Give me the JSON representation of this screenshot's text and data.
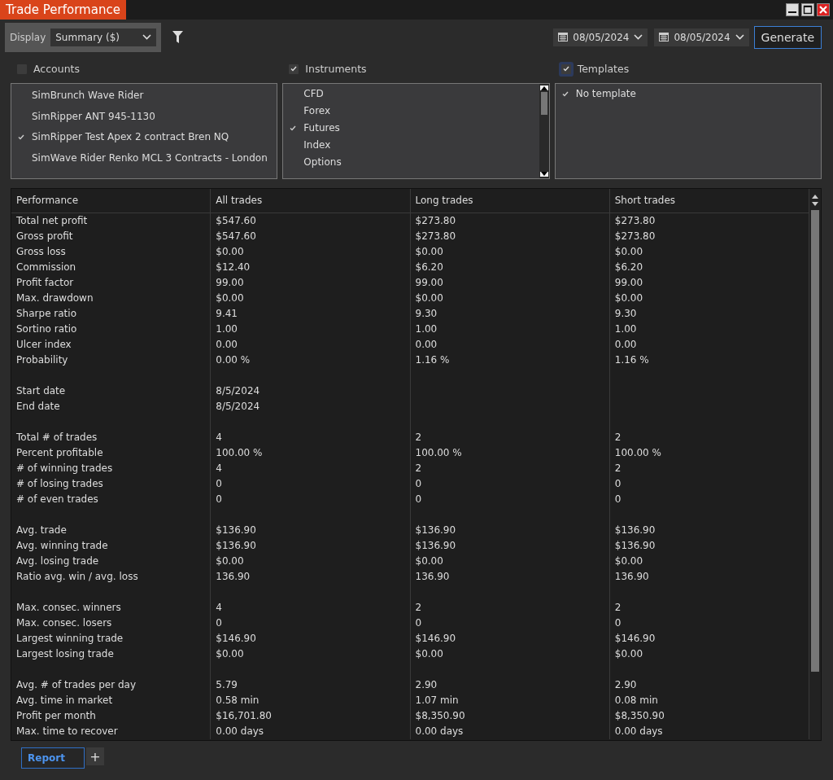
{
  "window": {
    "title": "Trade Performance"
  },
  "toolbar": {
    "display_label": "Display",
    "display_value": "Summary ($)",
    "from_date": "08/05/2024",
    "to_date": "08/05/2024",
    "generate_button": "Generate"
  },
  "filters": [
    {
      "label": "Accounts",
      "checked": false,
      "items": [
        {
          "label": "SimBrunch Wave Rider",
          "checked": false
        },
        {
          "label": "SimRipper ANT 945-1130",
          "checked": false
        },
        {
          "label": "SimRipper Test Apex 2 contract Bren NQ",
          "checked": true
        },
        {
          "label": "SimWave Rider Renko MCL 3 Contracts - London",
          "checked": false
        }
      ],
      "scrollbar": false
    },
    {
      "label": "Instruments",
      "checked": true,
      "items": [
        {
          "label": "CFD",
          "checked": false
        },
        {
          "label": "Forex",
          "checked": false
        },
        {
          "label": "Futures",
          "checked": true
        },
        {
          "label": "Index",
          "checked": false
        },
        {
          "label": "Options",
          "checked": false
        }
      ],
      "scrollbar": true
    },
    {
      "label": "Templates",
      "checked": true,
      "items": [
        {
          "label": "No template",
          "checked": true
        }
      ],
      "scrollbar": false
    }
  ],
  "table": {
    "columns": [
      "Performance",
      "All trades",
      "Long trades",
      "Short trades"
    ],
    "rows": [
      {
        "kind": "data",
        "cells": [
          "Total net profit",
          "$547.60",
          "$273.80",
          "$273.80"
        ]
      },
      {
        "kind": "data",
        "cells": [
          "Gross profit",
          "$547.60",
          "$273.80",
          "$273.80"
        ]
      },
      {
        "kind": "data",
        "cells": [
          "Gross loss",
          "$0.00",
          "$0.00",
          "$0.00"
        ]
      },
      {
        "kind": "data",
        "cells": [
          "Commission",
          "$12.40",
          "$6.20",
          "$6.20"
        ]
      },
      {
        "kind": "data",
        "cells": [
          "Profit factor",
          "99.00",
          "99.00",
          "99.00"
        ]
      },
      {
        "kind": "data",
        "cells": [
          "Max. drawdown",
          "$0.00",
          "$0.00",
          "$0.00"
        ]
      },
      {
        "kind": "data",
        "cells": [
          "Sharpe ratio",
          "9.41",
          "9.30",
          "9.30"
        ]
      },
      {
        "kind": "data",
        "cells": [
          "Sortino ratio",
          "1.00",
          "1.00",
          "1.00"
        ]
      },
      {
        "kind": "data",
        "cells": [
          "Ulcer index",
          "0.00",
          "0.00",
          "0.00"
        ]
      },
      {
        "kind": "data",
        "cells": [
          "Probability",
          "0.00 %",
          "1.16 %",
          "1.16 %"
        ]
      },
      {
        "kind": "spacer"
      },
      {
        "kind": "data",
        "cells": [
          "Start date",
          "8/5/2024"
        ]
      },
      {
        "kind": "data",
        "cells": [
          "End date",
          "8/5/2024"
        ]
      },
      {
        "kind": "spacer"
      },
      {
        "kind": "data",
        "cells": [
          "Total # of trades",
          "4",
          "2",
          "2"
        ]
      },
      {
        "kind": "data",
        "cells": [
          "Percent profitable",
          "100.00 %",
          "100.00 %",
          "100.00 %"
        ]
      },
      {
        "kind": "data",
        "cells": [
          "# of winning trades",
          "4",
          "2",
          "2"
        ]
      },
      {
        "kind": "data",
        "cells": [
          "# of losing trades",
          "0",
          "0",
          "0"
        ]
      },
      {
        "kind": "data",
        "cells": [
          "# of even trades",
          "0",
          "0",
          "0"
        ]
      },
      {
        "kind": "spacer"
      },
      {
        "kind": "data",
        "cells": [
          "Avg. trade",
          "$136.90",
          "$136.90",
          "$136.90"
        ]
      },
      {
        "kind": "data",
        "cells": [
          "Avg. winning trade",
          "$136.90",
          "$136.90",
          "$136.90"
        ]
      },
      {
        "kind": "data",
        "cells": [
          "Avg. losing trade",
          "$0.00",
          "$0.00",
          "$0.00"
        ]
      },
      {
        "kind": "data",
        "cells": [
          "Ratio avg. win / avg. loss",
          "136.90",
          "136.90",
          "136.90"
        ]
      },
      {
        "kind": "spacer"
      },
      {
        "kind": "data",
        "cells": [
          "Max. consec. winners",
          "4",
          "2",
          "2"
        ]
      },
      {
        "kind": "data",
        "cells": [
          "Max. consec. losers",
          "0",
          "0",
          "0"
        ]
      },
      {
        "kind": "data",
        "cells": [
          "Largest winning trade",
          "$146.90",
          "$146.90",
          "$146.90"
        ]
      },
      {
        "kind": "data",
        "cells": [
          "Largest losing trade",
          "$0.00",
          "$0.00",
          "$0.00"
        ]
      },
      {
        "kind": "spacer"
      },
      {
        "kind": "data",
        "cells": [
          "Avg. # of trades per day",
          "5.79",
          "2.90",
          "2.90"
        ]
      },
      {
        "kind": "data",
        "cells": [
          "Avg. time in market",
          "0.58 min",
          "1.07 min",
          "0.08 min"
        ]
      },
      {
        "kind": "data",
        "cells": [
          "Profit per month",
          "$16,701.80",
          "$8,350.90",
          "$8,350.90"
        ]
      },
      {
        "kind": "data",
        "cells": [
          "Max. time to recover",
          "0.00 days",
          "0.00 days",
          "0.00 days"
        ]
      }
    ]
  },
  "tabs": [
    {
      "label": "Report",
      "selected": true
    }
  ],
  "add_tab_button": "+"
}
